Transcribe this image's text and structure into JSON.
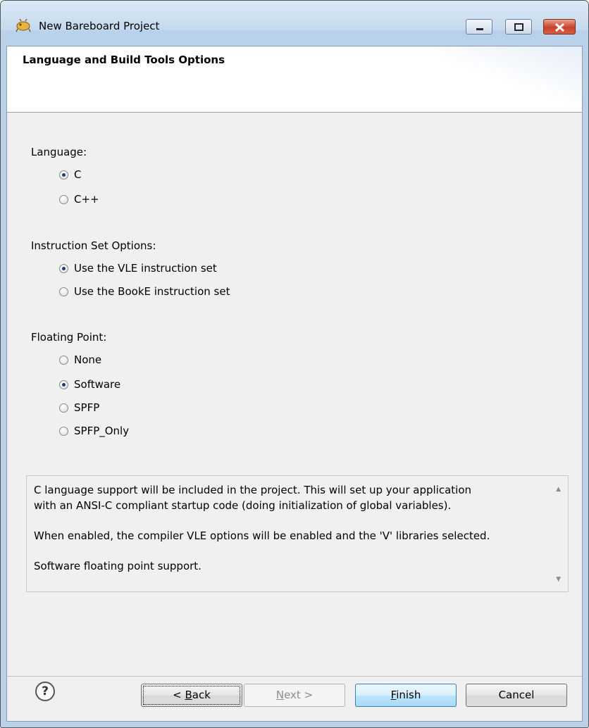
{
  "window": {
    "title": "New Bareboard Project"
  },
  "banner": {
    "title": "Language and Build Tools Options"
  },
  "language": {
    "label": "Language:",
    "options": [
      {
        "label": "C",
        "selected": true
      },
      {
        "label": "C++",
        "selected": false
      }
    ]
  },
  "instruction_set": {
    "label": "Instruction Set Options:",
    "options": [
      {
        "label": "Use the VLE instruction set",
        "selected": true
      },
      {
        "label": "Use the BookE instruction set",
        "selected": false
      }
    ]
  },
  "floating_point": {
    "label": "Floating Point:",
    "options": [
      {
        "label": "None",
        "selected": false
      },
      {
        "label": "Software",
        "selected": true
      },
      {
        "label": "SPFP",
        "selected": false
      },
      {
        "label": "SPFP_Only",
        "selected": false
      }
    ]
  },
  "description": {
    "line1": "C language support will be included in the project. This will set up your application",
    "line2": "with an ANSI-C compliant startup code (doing initialization of global variables).",
    "line3": "When enabled, the compiler VLE options will be enabled and the 'V' libraries selected.",
    "line4": "Software floating point support."
  },
  "buttons": {
    "help": "?",
    "back_prefix": "< ",
    "back_key": "B",
    "back_rest": "ack",
    "next_key": "N",
    "next_rest": "ext >",
    "finish_key": "F",
    "finish_rest": "inish",
    "cancel": "Cancel"
  }
}
